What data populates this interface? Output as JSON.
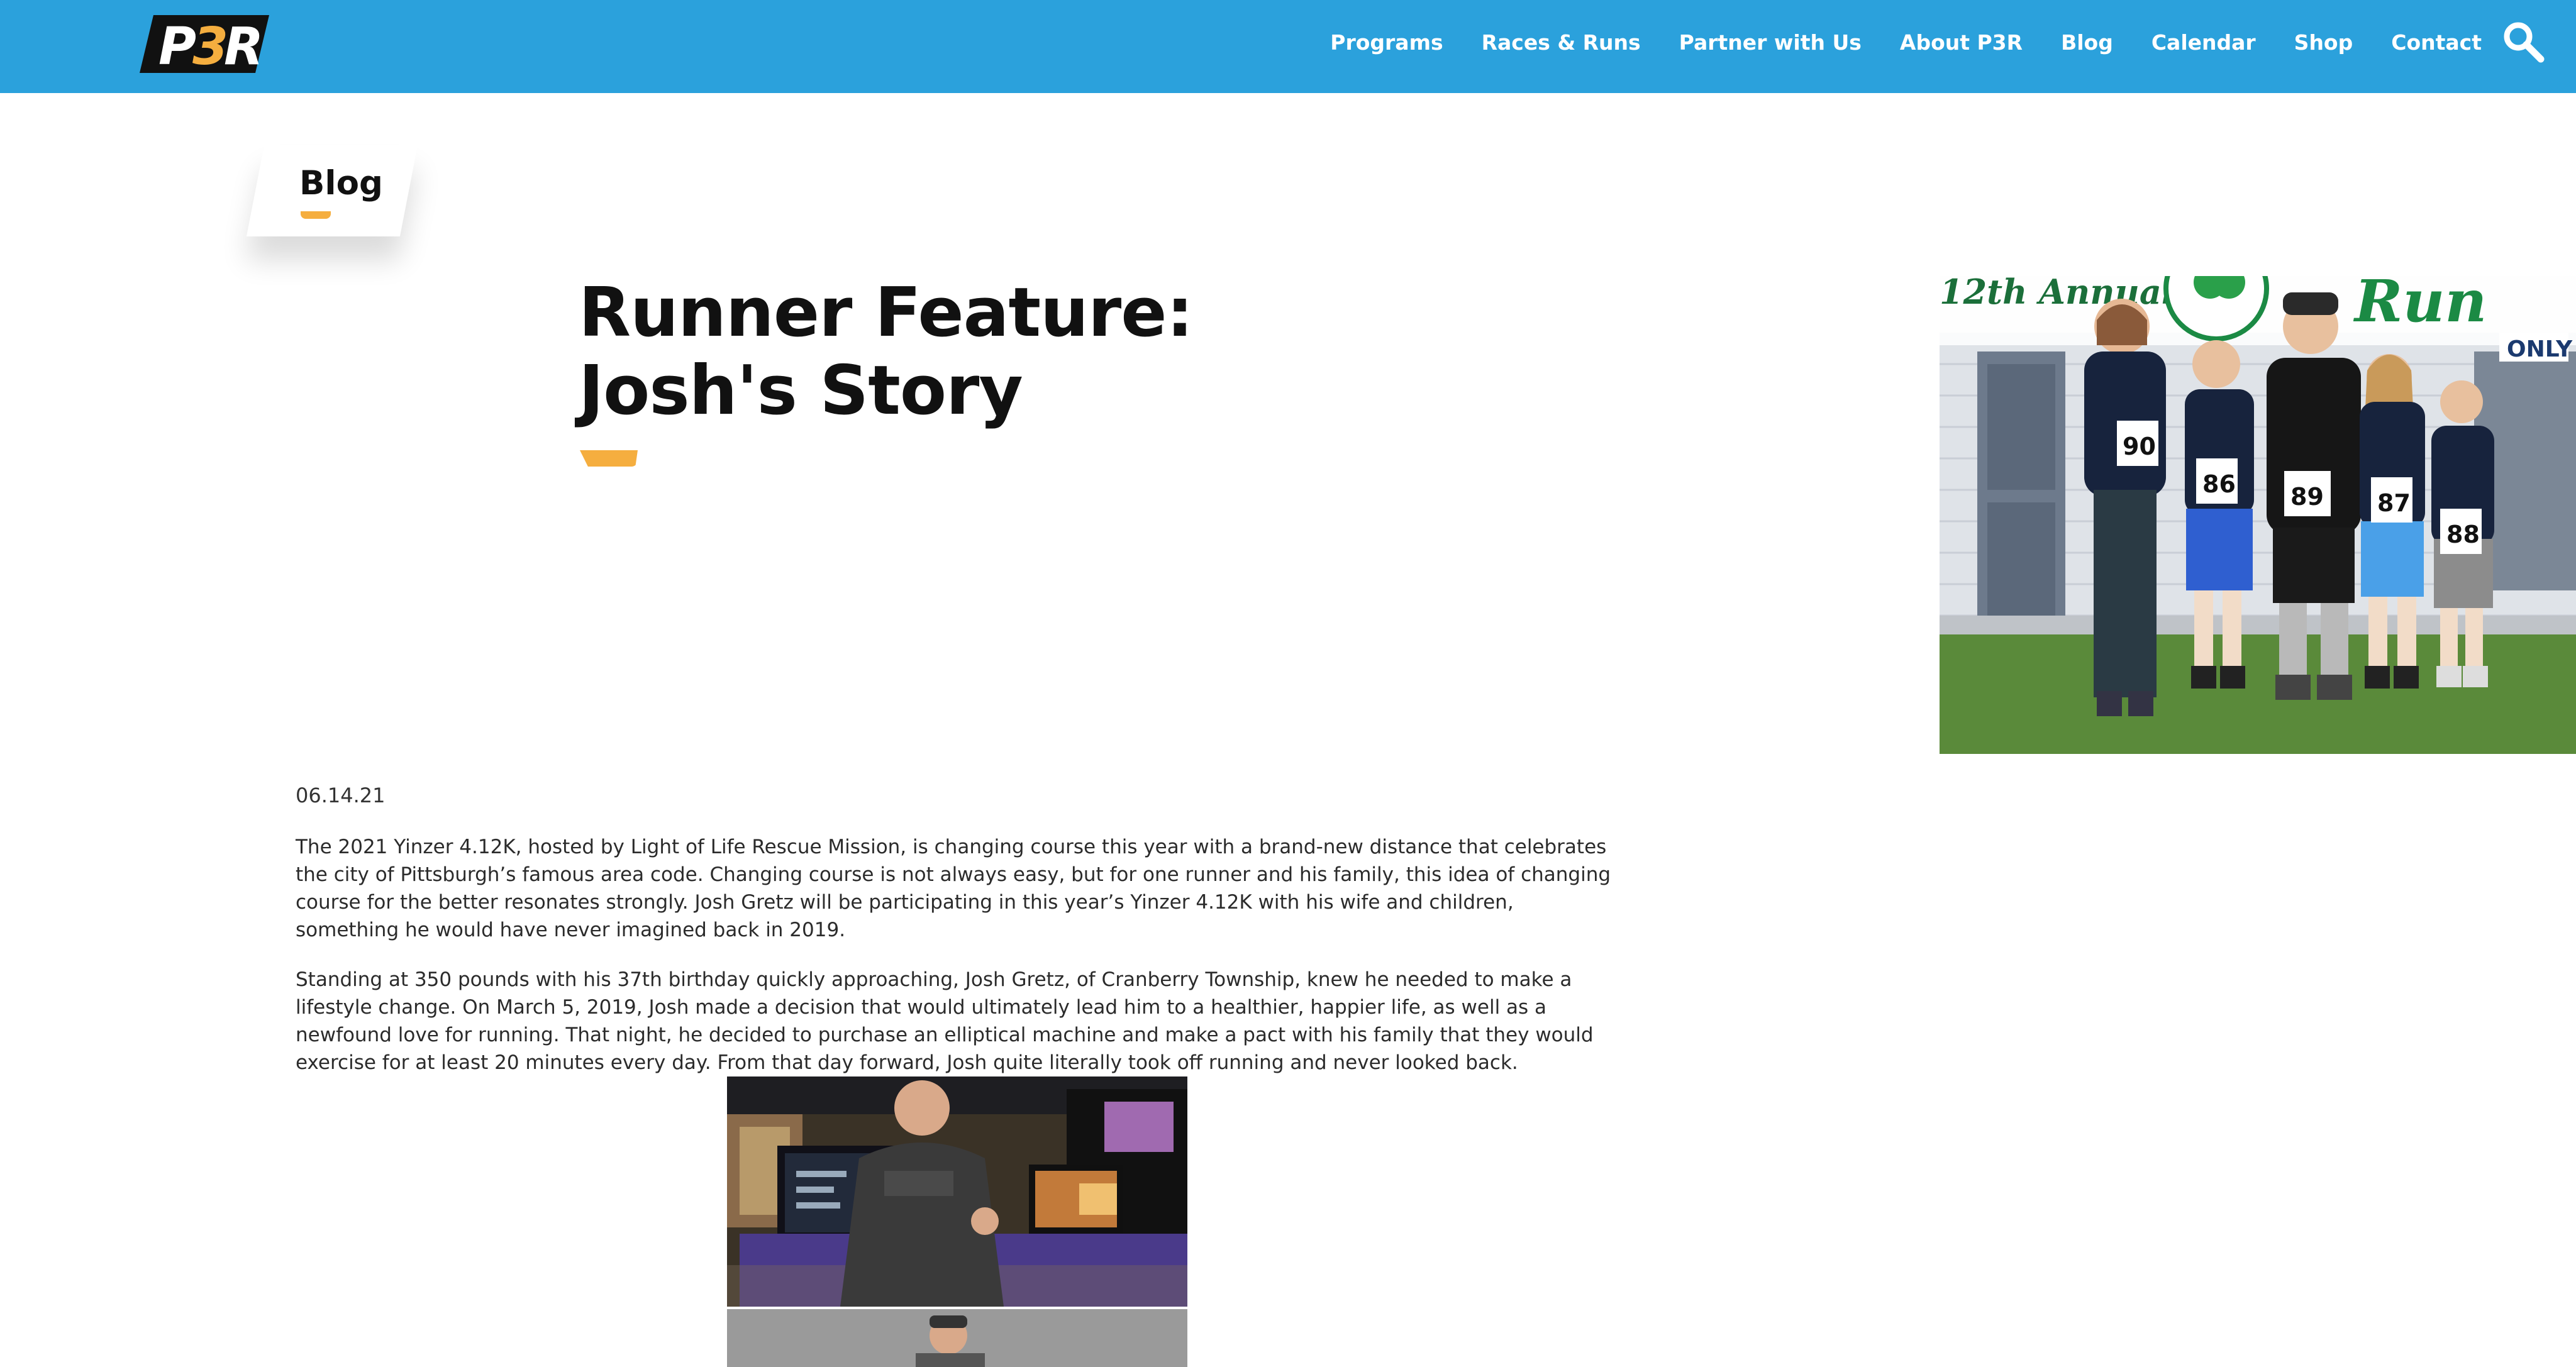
{
  "header": {
    "logo_text": "P3R",
    "nav_items": [
      "Programs",
      "Races & Runs",
      "Partner with Us",
      "About P3R",
      "Blog",
      "Calendar",
      "Shop",
      "Contact"
    ],
    "search_icon": "search-icon"
  },
  "section_tag": {
    "label": "Blog"
  },
  "article": {
    "title": "Runner Feature: Josh's Story",
    "date": "06.14.21",
    "paragraphs": [
      "The 2021 Yinzer 4.12K, hosted by Light of Life Rescue Mission, is changing course this year with a brand-new distance that celebrates the city of Pittsburgh’s famous area code. Changing course is not always easy, but for one runner and his family, this idea of changing course for the better resonates strongly. Josh Gretz will be participating in this year’s Yinzer 4.12K with his wife and children, something he would have never imagined back in 2019.",
      "Standing at 350 pounds with his 37th birthday quickly approaching, Josh Gretz, of Cranberry Township, knew he needed to make a lifestyle change. On March 5, 2019, Josh made a decision that would ultimately lead him to a healthier, happier life, as well as a newfound love for running. That night, he decided to purchase an elliptical machine and make a pact with his family that they would exercise for at least 20 minutes every day. From that day forward, Josh quite literally took off running and never looked back."
    ],
    "hero_banner_text": "12th Annual",
    "hero_banner_word": "Run",
    "hero_sign_text": "ONLY",
    "bib_numbers": [
      "90",
      "86",
      "89",
      "87",
      "88"
    ]
  },
  "colors": {
    "header_bg": "#2ba1dc",
    "accent": "#f5ae3f",
    "title_text": "#111111",
    "body_text": "#2b2b2b"
  }
}
